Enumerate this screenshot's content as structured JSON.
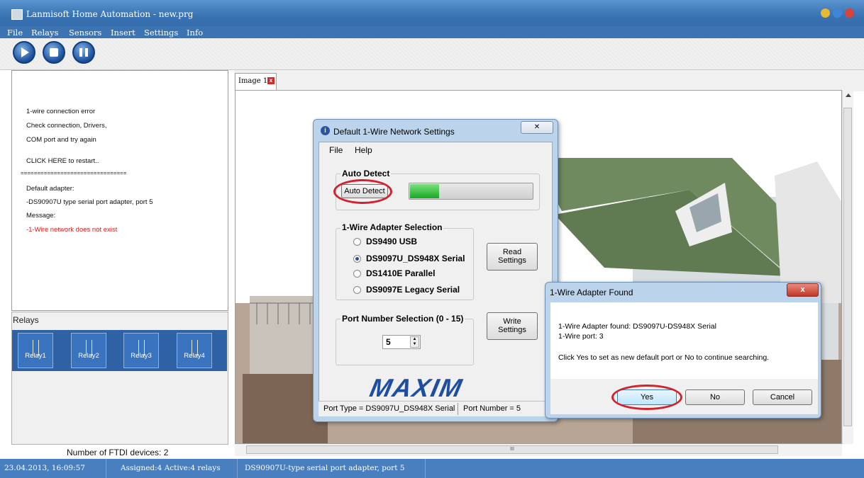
{
  "window": {
    "title": "Lanmisoft Home Automation - new.prg"
  },
  "menu": [
    "File",
    "Relays",
    "Sensors",
    "Insert",
    "Settings",
    "Info"
  ],
  "toolbar": {
    "buttons": [
      "play-icon",
      "stop-icon",
      "pause-icon"
    ]
  },
  "log": {
    "lines": [
      "1-wire connection error",
      "Check connection, Drivers,",
      "COM port and try again",
      "CLICK HERE to restart..",
      "================================",
      "Default adapter:",
      "-DS90907U type serial port adapter, port 5",
      "Message:",
      "-1-Wire network does not exist"
    ],
    "error_color": "#d42020"
  },
  "relays": {
    "title": "Relays",
    "items": [
      "Relay1",
      "Relay2",
      "Relay3",
      "Relay4"
    ]
  },
  "ftdi": {
    "count_text": "Number of FTDI devices: 2"
  },
  "tabs": [
    {
      "label": "Image 1",
      "close": "x"
    }
  ],
  "hscroll_label": "III",
  "statusbar": {
    "datetime": "23.04.2013, 16:09:57",
    "relays": "Assigned:4 Active:4 relays",
    "adapter": "DS90907U-type serial port adapter, port 5"
  },
  "network_dialog": {
    "title": "Default 1-Wire Network Settings",
    "menu": [
      "File",
      "Help"
    ],
    "auto_detect": {
      "group": "Auto Detect",
      "button": "Auto Detect",
      "progress": 0.24
    },
    "adapter": {
      "group": "1-Wire Adapter Selection",
      "options": [
        "DS9490 USB",
        "DS9097U_DS948X Serial",
        "DS1410E Parallel",
        "DS9097E Legacy Serial"
      ],
      "selected": "DS9097U_DS948X Serial",
      "read_button": [
        "Read",
        "Settings"
      ]
    },
    "port": {
      "group": "Port Number Selection (0 - 15)",
      "value": "5",
      "write_button": [
        "Write",
        "Settings"
      ]
    },
    "logo": "MAXIM",
    "status": {
      "port_type": "Port Type = DS9097U_DS948X Serial",
      "port_number": "Port Number = 5"
    }
  },
  "found_dialog": {
    "title": "1-Wire Adapter Found",
    "close": "x",
    "line1": "1-Wire Adapter found:  DS9097U-DS948X Serial",
    "line2": "1-Wire port: 3",
    "line3": "Click Yes to set as new default port or No to continue searching.",
    "buttons": {
      "yes": "Yes",
      "no": "No",
      "cancel": "Cancel"
    }
  },
  "colors": {
    "accent": "#3c74b3",
    "highlight_ring": "#d1232f",
    "progress": "#1fbd2a"
  }
}
